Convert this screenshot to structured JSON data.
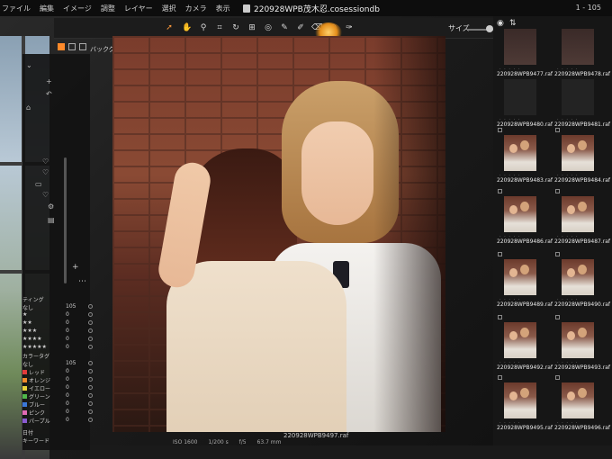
{
  "menubar": {
    "items": [
      "ファイル",
      "編集",
      "イメージ",
      "調整",
      "レイヤー",
      "選択",
      "カメラ",
      "表示"
    ],
    "document_title": "220928WPB茂木忍.cosessiondb",
    "counter": "1 - 105"
  },
  "toolbar": {
    "size_label": "サイズ",
    "icons": [
      "cursor-icon",
      "pan-icon",
      "zoom-icon",
      "crop-icon",
      "rotate-icon",
      "keystone-icon",
      "spot-icon",
      "picker-icon",
      "brush-icon",
      "eraser-icon",
      "gradient-icon",
      "text-icon"
    ]
  },
  "subbar": {
    "background_select": "バックグラウンド ≑",
    "add": "+ ·"
  },
  "leftpanel": {
    "keyword_rows": [
      {
        "label": "ティング",
        "count": ""
      },
      {
        "label": "なし",
        "count": "105"
      },
      {
        "label": "★",
        "count": "0"
      },
      {
        "label": "★★",
        "count": "0"
      },
      {
        "label": "★★★",
        "count": "0"
      },
      {
        "label": "★★★★",
        "count": "0"
      },
      {
        "label": "★★★★★",
        "count": "0"
      },
      {
        "label": "カラータグ",
        "count": ""
      },
      {
        "label": "なし",
        "count": "105"
      },
      {
        "label": "レッド",
        "count": "0",
        "swatch": "#e23b3b"
      },
      {
        "label": "オレンジ",
        "count": "0",
        "swatch": "#f08a2a"
      },
      {
        "label": "イエロー",
        "count": "0",
        "swatch": "#e8d23a"
      },
      {
        "label": "グリーン",
        "count": "0",
        "swatch": "#4fb84a"
      },
      {
        "label": "ブルー",
        "count": "0",
        "swatch": "#3a78d8"
      },
      {
        "label": "ピンク",
        "count": "0",
        "swatch": "#e06ab4"
      },
      {
        "label": "パープル",
        "count": "0",
        "swatch": "#8a5ad0"
      },
      {
        "label": "日付",
        "count": ""
      },
      {
        "label": "キーワード",
        "count": ""
      }
    ]
  },
  "viewer": {
    "filename": "220928WPB9497.raf",
    "exif": [
      "ISO 1600",
      "1/200 s",
      "f/5",
      "63.7 mm"
    ]
  },
  "thumbnails": [
    {
      "label": "220928WPB9477.raf",
      "kind": "dark"
    },
    {
      "label": "220928WPB9478.raf",
      "kind": "dark"
    },
    {
      "label": "220928WPB9480.raf",
      "kind": "blank"
    },
    {
      "label": "220928WPB9481.raf",
      "kind": "blank"
    },
    {
      "label": "220928WPB9483.raf",
      "kind": "photo"
    },
    {
      "label": "220928WPB9484.raf",
      "kind": "photo"
    },
    {
      "label": "220928WPB9486.raf",
      "kind": "photo"
    },
    {
      "label": "220928WPB9487.raf",
      "kind": "photo"
    },
    {
      "label": "220928WPB9489.raf",
      "kind": "photo"
    },
    {
      "label": "220928WPB9490.raf",
      "kind": "photo"
    },
    {
      "label": "220928WPB9492.raf",
      "kind": "photo"
    },
    {
      "label": "220928WPB9493.raf",
      "kind": "photo"
    },
    {
      "label": "220928WPB9495.raf",
      "kind": "photo"
    },
    {
      "label": "220928WPB9496.raf",
      "kind": "photo"
    }
  ],
  "colors": {
    "accent": "#ff8a2a",
    "panel": "#161616",
    "toolbar": "#1c1c1c"
  }
}
